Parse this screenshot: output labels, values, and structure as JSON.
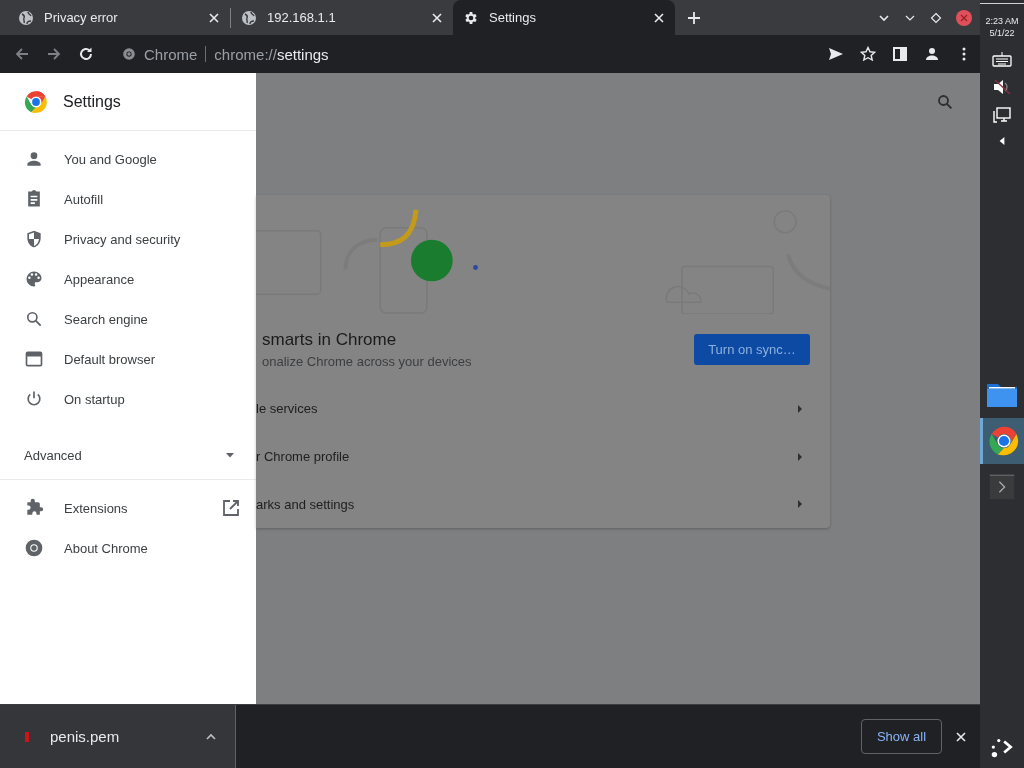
{
  "tabs": [
    {
      "title": "Privacy error",
      "selected": false
    },
    {
      "title": "192.168.1.1",
      "selected": false
    },
    {
      "title": "Settings",
      "selected": true
    }
  ],
  "omnibox": {
    "site": "Chrome",
    "url_prefix": "chrome://",
    "url_path": "settings"
  },
  "drawer": {
    "title": "Settings",
    "items": [
      {
        "label": "You and Google"
      },
      {
        "label": "Autofill"
      },
      {
        "label": "Privacy and security"
      },
      {
        "label": "Appearance"
      },
      {
        "label": "Search engine"
      },
      {
        "label": "Default browser"
      },
      {
        "label": "On startup"
      }
    ],
    "advanced": {
      "label": "Advanced",
      "expanded": false
    },
    "footer_items": [
      {
        "label": "Extensions"
      },
      {
        "label": "About Chrome"
      }
    ]
  },
  "page": {
    "heading": "smarts in Chrome",
    "subtitle": "onalize Chrome across your devices",
    "button": "Turn on sync…",
    "rows": [
      "le services",
      "r Chrome profile",
      "arks and settings"
    ]
  },
  "download": {
    "filename": "penis.pem",
    "button": "Show all"
  },
  "shelf": {
    "time": "2:23 AM",
    "date": "5/1/22",
    "apps": [
      {
        "selected": false
      },
      {
        "selected": true
      },
      {
        "selected": false
      }
    ]
  }
}
